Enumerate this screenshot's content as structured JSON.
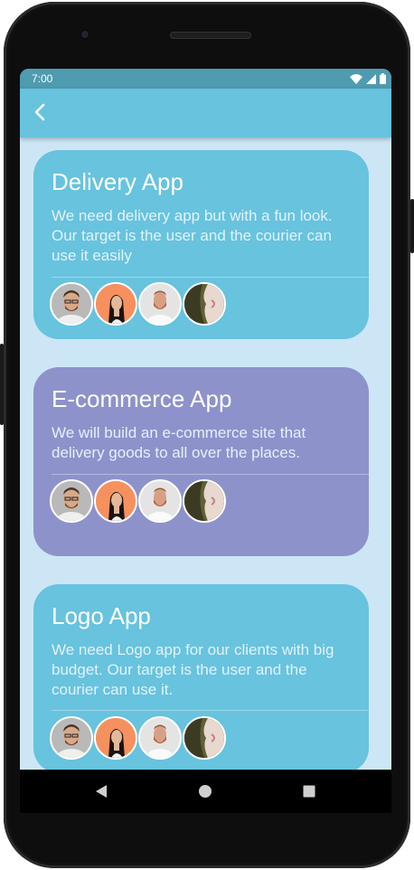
{
  "status_bar": {
    "time": "7:00",
    "icons": [
      "wifi-icon",
      "signal-icon",
      "battery-icon"
    ]
  },
  "app_bar": {
    "back_icon": "chevron-left-icon",
    "color": "#67c3de"
  },
  "projects": [
    {
      "title": "Delivery App",
      "description": "We need delivery app but with a fun look.\nOur target is the user and the courier can\nuse it easily",
      "color": "#67c3de",
      "members": [
        "man-glasses",
        "woman-orange",
        "man-beard",
        "woman-profile"
      ]
    },
    {
      "title": "E-commerce App",
      "description": "We will build an e-commerce site that\ndelivery goods to all over the places.",
      "color": "#8e92cb",
      "members": [
        "man-glasses",
        "woman-orange",
        "man-beard",
        "woman-profile"
      ]
    },
    {
      "title": "Logo App",
      "description": "We need Logo app for our clients with big\nbudget. Our target is the user and the\ncourier can use it.",
      "color": "#67c3de",
      "members": [
        "man-glasses",
        "woman-orange",
        "man-beard",
        "woman-profile"
      ]
    }
  ],
  "nav_bar": {
    "icons": [
      "back-triangle-icon",
      "home-circle-icon",
      "recents-square-icon"
    ]
  }
}
